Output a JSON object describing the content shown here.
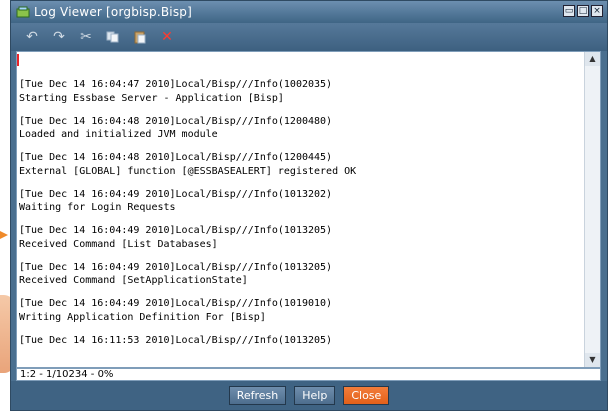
{
  "window": {
    "title": "Log Viewer  [orgbisp.Bisp]",
    "icon": "log-viewer-app-icon",
    "controls": [
      "restore-icon",
      "maximize-icon",
      "close-window-icon"
    ]
  },
  "toolbar": {
    "buttons": [
      {
        "name": "undo-icon",
        "glyph": "↶"
      },
      {
        "name": "redo-icon",
        "glyph": "↷"
      },
      {
        "name": "cut-icon",
        "glyph": "✂"
      },
      {
        "name": "copy-icon",
        "glyph": "⧉"
      },
      {
        "name": "paste-icon",
        "glyph": "📋"
      },
      {
        "name": "delete-icon",
        "glyph": "✕"
      }
    ]
  },
  "log": {
    "entries": [
      {
        "header": "[Tue Dec 14 16:04:47 2010]Local/Bisp///Info(1002035)",
        "message": "Starting Essbase Server - Application [Bisp]"
      },
      {
        "header": "[Tue Dec 14 16:04:48 2010]Local/Bisp///Info(1200480)",
        "message": "Loaded and initialized JVM module"
      },
      {
        "header": "[Tue Dec 14 16:04:48 2010]Local/Bisp///Info(1200445)",
        "message": "External [GLOBAL] function [@ESSBASEALERT] registered OK"
      },
      {
        "header": "[Tue Dec 14 16:04:49 2010]Local/Bisp///Info(1013202)",
        "message": "Waiting for Login Requests"
      },
      {
        "header": "[Tue Dec 14 16:04:49 2010]Local/Bisp///Info(1013205)",
        "message": "Received Command [List Databases]"
      },
      {
        "header": "[Tue Dec 14 16:04:49 2010]Local/Bisp///Info(1013205)",
        "message": "Received Command [SetApplicationState]"
      },
      {
        "header": "[Tue Dec 14 16:04:49 2010]Local/Bisp///Info(1019010)",
        "message": "Writing Application Definition For [Bisp]"
      },
      {
        "header": "[Tue Dec 14 16:11:53 2010]Local/Bisp///Info(1013205)",
        "message": ""
      }
    ]
  },
  "status": {
    "position": "1:2 - 1/10234 - 0%"
  },
  "footer": {
    "refresh": "Refresh",
    "help": "Help",
    "close": "Close"
  }
}
